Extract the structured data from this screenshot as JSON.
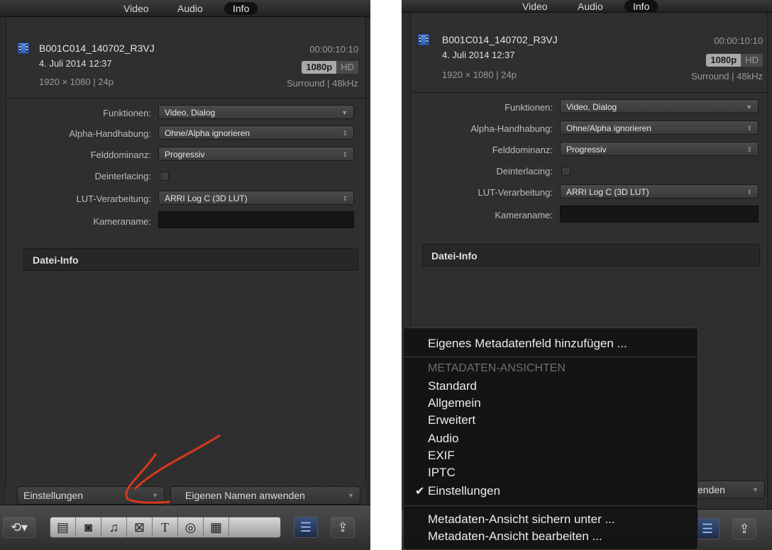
{
  "tabs": [
    "Video",
    "Audio",
    "Info"
  ],
  "clip": {
    "name": "B001C014_140702_R3VJ",
    "timecode": "00:00:10:10",
    "date": "4. Juli 2014 12:37",
    "resolution": "1920 × 1080  |  24p",
    "badge_main": "1080p",
    "badge_hd": "HD",
    "audio": "Surround  |  48kHz"
  },
  "fields": {
    "funktionen_label": "Funktionen:",
    "funktionen_value": "Video, Dialog",
    "alpha_label": "Alpha-Handhabung:",
    "alpha_value": "Ohne/Alpha ignorieren",
    "feld_label": "Felddominanz:",
    "feld_value": "Progressiv",
    "deint_label": "Deinterlacing:",
    "lut_label": "LUT-Verarbeitung:",
    "lut_value": "ARRI Log C (3D LUT)",
    "kamera_label": "Kameraname:"
  },
  "section_title": "Datei-Info",
  "bottom": {
    "view_select": "Einstellungen",
    "apply_name": "Eigenen Namen anwenden",
    "apply_name_partial": "enden"
  },
  "menu": {
    "add_field": "Eigenes Metadatenfeld hinzufügen ...",
    "views_header": "METADATEN-ANSICHTEN",
    "views": [
      "Standard",
      "Allgemein",
      "Erweitert",
      "Audio",
      "EXIF",
      "IPTC",
      "Einstellungen"
    ],
    "checked": "✔",
    "save_view": "Metadaten-Ansicht sichern unter ...",
    "edit_view": "Metadaten-Ansicht bearbeiten ..."
  },
  "colors": {
    "annotation_arrow": "#d9381e",
    "panel_bg": "#2f2f2f"
  },
  "icons": [
    "undo-icon",
    "filmstrip-icon",
    "camera-icon",
    "music-icon",
    "transition-icon",
    "title-icon",
    "generator-icon",
    "theme-icon",
    "inspector-icon",
    "share-icon"
  ]
}
